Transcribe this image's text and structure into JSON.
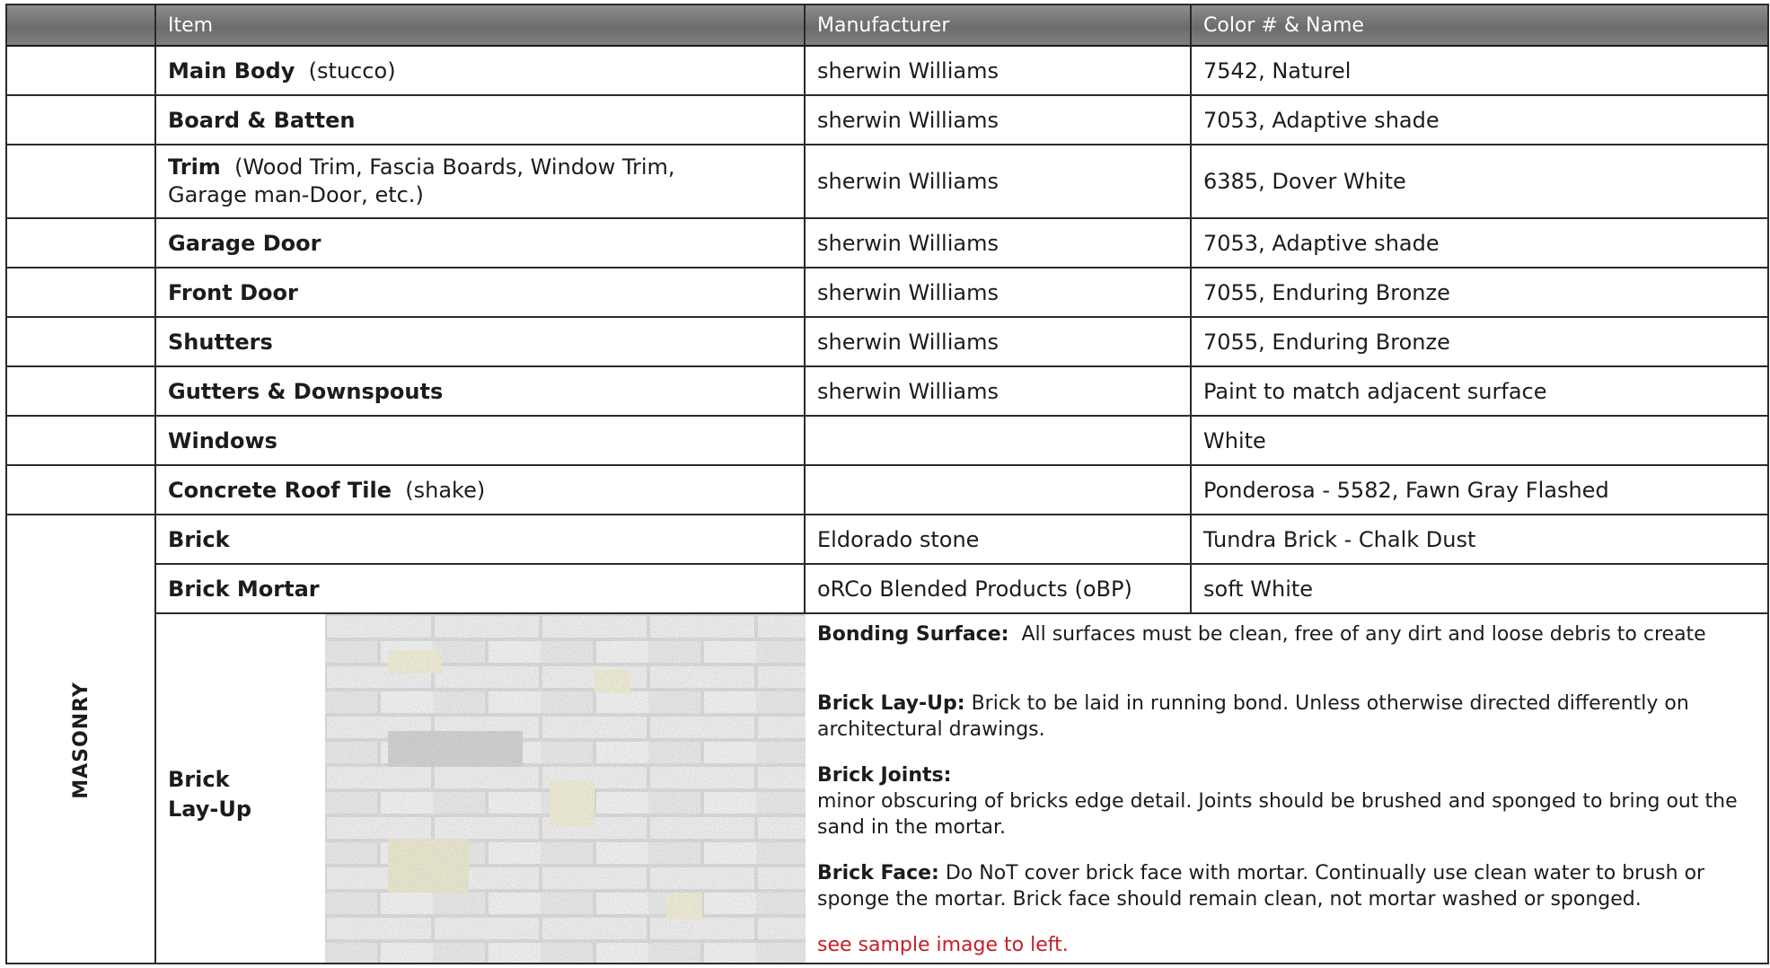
{
  "header": {
    "col_item": "Item",
    "col_manufacturer": "Manufacturer",
    "col_color": "Color # & Name"
  },
  "rows": [
    {
      "item": "Main Body",
      "note": "(stucco)",
      "manufacturer": "sherwin Williams",
      "color": "7542, Naturel"
    },
    {
      "item": "Board & Batten",
      "note": "",
      "manufacturer": "sherwin Williams",
      "color": "7053, Adaptive shade"
    },
    {
      "item": "Trim",
      "note": "(Wood Trim, Fascia Boards, Window Trim,",
      "note2": "Garage man-Door, etc.)",
      "manufacturer": "sherwin Williams",
      "color": "6385, Dover White"
    },
    {
      "item": "Garage Door",
      "note": "",
      "manufacturer": "sherwin Williams",
      "color": "7053, Adaptive shade"
    },
    {
      "item": "Front Door",
      "note": "",
      "manufacturer": "sherwin Williams",
      "color": "7055, Enduring Bronze"
    },
    {
      "item": "Shutters",
      "note": "",
      "manufacturer": "sherwin Williams",
      "color": "7055, Enduring Bronze"
    },
    {
      "item": "Gutters & Downspouts",
      "note": "",
      "manufacturer": "sherwin Williams",
      "color": "Paint to match adjacent surface"
    },
    {
      "item": "Windows",
      "note": "",
      "manufacturer": "",
      "color": "White"
    },
    {
      "item": "Concrete Roof Tile",
      "note": "(shake)",
      "manufacturer": "",
      "color": "Ponderosa - 5582, Fawn Gray Flashed"
    }
  ],
  "masonry": {
    "group_label": "MASONRY",
    "rows": [
      {
        "item": "Brick",
        "manufacturer": "Eldorado stone",
        "color": "Tundra Brick - Chalk Dust"
      },
      {
        "item": "Brick Mortar",
        "manufacturer": "oRCo Blended Products (oBP)",
        "color": "soft White"
      }
    ],
    "layup": {
      "label_line1": "Brick",
      "label_line2": "Lay-Up",
      "bonding_title": "Bonding Surface:",
      "bonding_text": "All surfaces must be clean, free of any dirt and loose debris to create",
      "layup_title": "Brick Lay-Up:",
      "layup_text": "Brick to be laid in running bond.  Unless otherwise directed differently on architectural drawings.",
      "joints_title": "Brick Joints:",
      "joints_text": "minor obscuring of bricks edge detail.  Joints should be brushed and sponged to bring out the sand in the mortar.",
      "face_title": "Brick Face:",
      "face_text": "Do NoT cover brick face with mortar.  Continually use clean water to brush or sponge the mortar.  Brick face should remain clean, not mortar washed or sponged.",
      "sample_note": "see sample image to left."
    }
  },
  "colors": {
    "header_bg": "#7a7a7a",
    "border": "#2a2a2a",
    "note_red": "#c3202a",
    "brick_light": "#e9e9e9",
    "brick_cream": "#ecead4"
  },
  "icons": {
    "brick_sample": "brick-wall-sample-image"
  }
}
